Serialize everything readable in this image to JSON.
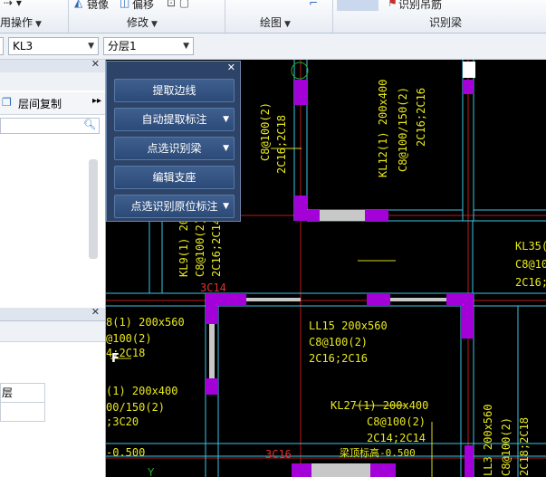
{
  "ribbon": {
    "group1_label": "用操作",
    "mirror_label": "镜像",
    "offset_label": "偏移",
    "modify_label": "修改",
    "draw_label": "绘图",
    "recognize_top_label": "识别吊筋",
    "recognize_label": "识别梁"
  },
  "combos": {
    "component": "KL3",
    "layer": "分层1"
  },
  "left_panel": {
    "floor_copy_label": "层间复制",
    "more": "▸▸",
    "table_cell_1": "层"
  },
  "tool_panel": {
    "buttons": [
      {
        "label": "提取边线"
      },
      {
        "label": "自动提取标注"
      },
      {
        "label": "点选识别梁"
      },
      {
        "label": "编辑支座"
      },
      {
        "label": "点选识别原位标注"
      }
    ]
  },
  "cad_text": {
    "t1": "C8@100(2)",
    "t2": "2C16;2C18",
    "t3": "KL12(1) 200x400",
    "t4": "C8@100/150(2)",
    "t5": "2C16;2C16",
    "t6": "KL9(1) 200x",
    "t7": "C8@100(2)",
    "t8": "2C16;2C14",
    "t9": "3C14",
    "t10": "KL35(",
    "t11": "C8@10",
    "t12": "2C16;",
    "t13": "8(1) 200x560",
    "t14": "@100(2)",
    "t15": "4;2C18",
    "t16": "LL15 200x560",
    "t17": "C8@100(2)",
    "t18": "2C16;2C16",
    "t19": "(1) 200x400",
    "t20": "00/150(2)",
    "t21": ";3C20",
    "t22": "-0.500",
    "t23": "KL27(1) 200x400",
    "t24": "C8@100(2)",
    "t25": "2C14;2C14",
    "t26": "梁顶标高-0.500",
    "t27": "3C16",
    "t28": "LL3 200x560",
    "t29": "C8@100(2)",
    "t30": "2C18;2C18"
  }
}
